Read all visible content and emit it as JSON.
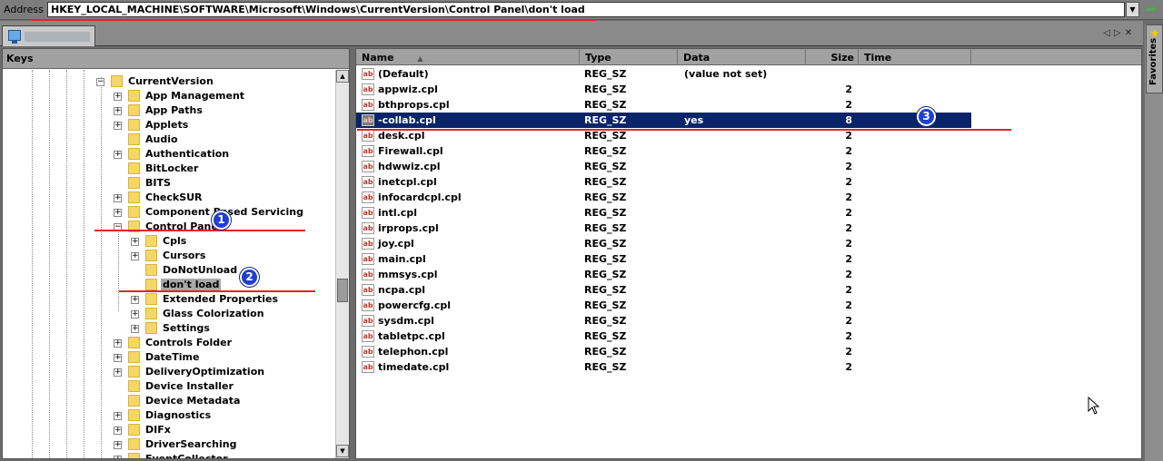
{
  "address": {
    "label": "Address",
    "value": "HKEY_LOCAL_MACHINE\\SOFTWARE\\Microsoft\\Windows\\CurrentVersion\\Control Panel\\don't load"
  },
  "favorites": {
    "label": "Favorites"
  },
  "keys": {
    "header": "Keys",
    "nodes": [
      {
        "label": "CurrentVersion",
        "level": 0,
        "expander": "-"
      },
      {
        "label": "App Management",
        "level": 1,
        "expander": "+"
      },
      {
        "label": "App Paths",
        "level": 1,
        "expander": "+"
      },
      {
        "label": "Applets",
        "level": 1,
        "expander": "+"
      },
      {
        "label": "Audio",
        "level": 1,
        "expander": ""
      },
      {
        "label": "Authentication",
        "level": 1,
        "expander": "+"
      },
      {
        "label": "BitLocker",
        "level": 1,
        "expander": ""
      },
      {
        "label": "BITS",
        "level": 1,
        "expander": ""
      },
      {
        "label": "CheckSUR",
        "level": 1,
        "expander": "+"
      },
      {
        "label": "Component Based Servicing",
        "level": 1,
        "expander": "+"
      },
      {
        "label": "Control Panel",
        "level": 1,
        "expander": "-"
      },
      {
        "label": "Cpls",
        "level": 2,
        "expander": "+"
      },
      {
        "label": "Cursors",
        "level": 2,
        "expander": "+"
      },
      {
        "label": "DoNotUnload",
        "level": 2,
        "expander": ""
      },
      {
        "label": "don't load",
        "level": 2,
        "expander": "",
        "selected": true
      },
      {
        "label": "Extended Properties",
        "level": 2,
        "expander": "+"
      },
      {
        "label": "Glass Colorization",
        "level": 2,
        "expander": "+"
      },
      {
        "label": "Settings",
        "level": 2,
        "expander": "+"
      },
      {
        "label": "Controls Folder",
        "level": 1,
        "expander": "+"
      },
      {
        "label": "DateTime",
        "level": 1,
        "expander": "+"
      },
      {
        "label": "DeliveryOptimization",
        "level": 1,
        "expander": "+"
      },
      {
        "label": "Device Installer",
        "level": 1,
        "expander": ""
      },
      {
        "label": "Device Metadata",
        "level": 1,
        "expander": ""
      },
      {
        "label": "Diagnostics",
        "level": 1,
        "expander": "+"
      },
      {
        "label": "DIFx",
        "level": 1,
        "expander": "+"
      },
      {
        "label": "DriverSearching",
        "level": 1,
        "expander": "+"
      },
      {
        "label": "EventCollector",
        "level": 1,
        "expander": "+"
      }
    ]
  },
  "values": {
    "columns": [
      {
        "label": "Name",
        "sort": "▲"
      },
      {
        "label": "Type"
      },
      {
        "label": "Data"
      },
      {
        "label": "Size"
      },
      {
        "label": "Time"
      }
    ],
    "rows": [
      {
        "name": "(Default)",
        "type": "REG_SZ",
        "data": "(value not set)",
        "size": ""
      },
      {
        "name": "appwiz.cpl",
        "type": "REG_SZ",
        "data": "",
        "size": "2"
      },
      {
        "name": "bthprops.cpl",
        "type": "REG_SZ",
        "data": "",
        "size": "2"
      },
      {
        "name": "-collab.cpl",
        "type": "REG_SZ",
        "data": "yes",
        "size": "8",
        "selected": true
      },
      {
        "name": "desk.cpl",
        "type": "REG_SZ",
        "data": "",
        "size": "2"
      },
      {
        "name": "Firewall.cpl",
        "type": "REG_SZ",
        "data": "",
        "size": "2"
      },
      {
        "name": "hdwwiz.cpl",
        "type": "REG_SZ",
        "data": "",
        "size": "2"
      },
      {
        "name": "inetcpl.cpl",
        "type": "REG_SZ",
        "data": "",
        "size": "2"
      },
      {
        "name": "infocardcpl.cpl",
        "type": "REG_SZ",
        "data": "",
        "size": "2"
      },
      {
        "name": "intl.cpl",
        "type": "REG_SZ",
        "data": "",
        "size": "2"
      },
      {
        "name": "irprops.cpl",
        "type": "REG_SZ",
        "data": "",
        "size": "2"
      },
      {
        "name": "joy.cpl",
        "type": "REG_SZ",
        "data": "",
        "size": "2"
      },
      {
        "name": "main.cpl",
        "type": "REG_SZ",
        "data": "",
        "size": "2"
      },
      {
        "name": "mmsys.cpl",
        "type": "REG_SZ",
        "data": "",
        "size": "2"
      },
      {
        "name": "ncpa.cpl",
        "type": "REG_SZ",
        "data": "",
        "size": "2"
      },
      {
        "name": "powercfg.cpl",
        "type": "REG_SZ",
        "data": "",
        "size": "2"
      },
      {
        "name": "sysdm.cpl",
        "type": "REG_SZ",
        "data": "",
        "size": "2"
      },
      {
        "name": "tabletpc.cpl",
        "type": "REG_SZ",
        "data": "",
        "size": "2"
      },
      {
        "name": "telephon.cpl",
        "type": "REG_SZ",
        "data": "",
        "size": "2"
      },
      {
        "name": "timedate.cpl",
        "type": "REG_SZ",
        "data": "",
        "size": "2"
      }
    ]
  },
  "annotations": {
    "badge1": "1",
    "badge2": "2",
    "badge3": "3"
  },
  "icons": {
    "go": "go-arrow-icon",
    "dropdown": "chevron-down-icon",
    "favorites": "star-icon",
    "folder": "folder-icon",
    "string_value": "ab-string-value-icon",
    "computer": "computer-icon"
  },
  "colors": {
    "selection": "#0a246a",
    "annotation_line": "#e8202a",
    "badge": "#1e3fcf",
    "folder": "#f5d766"
  }
}
